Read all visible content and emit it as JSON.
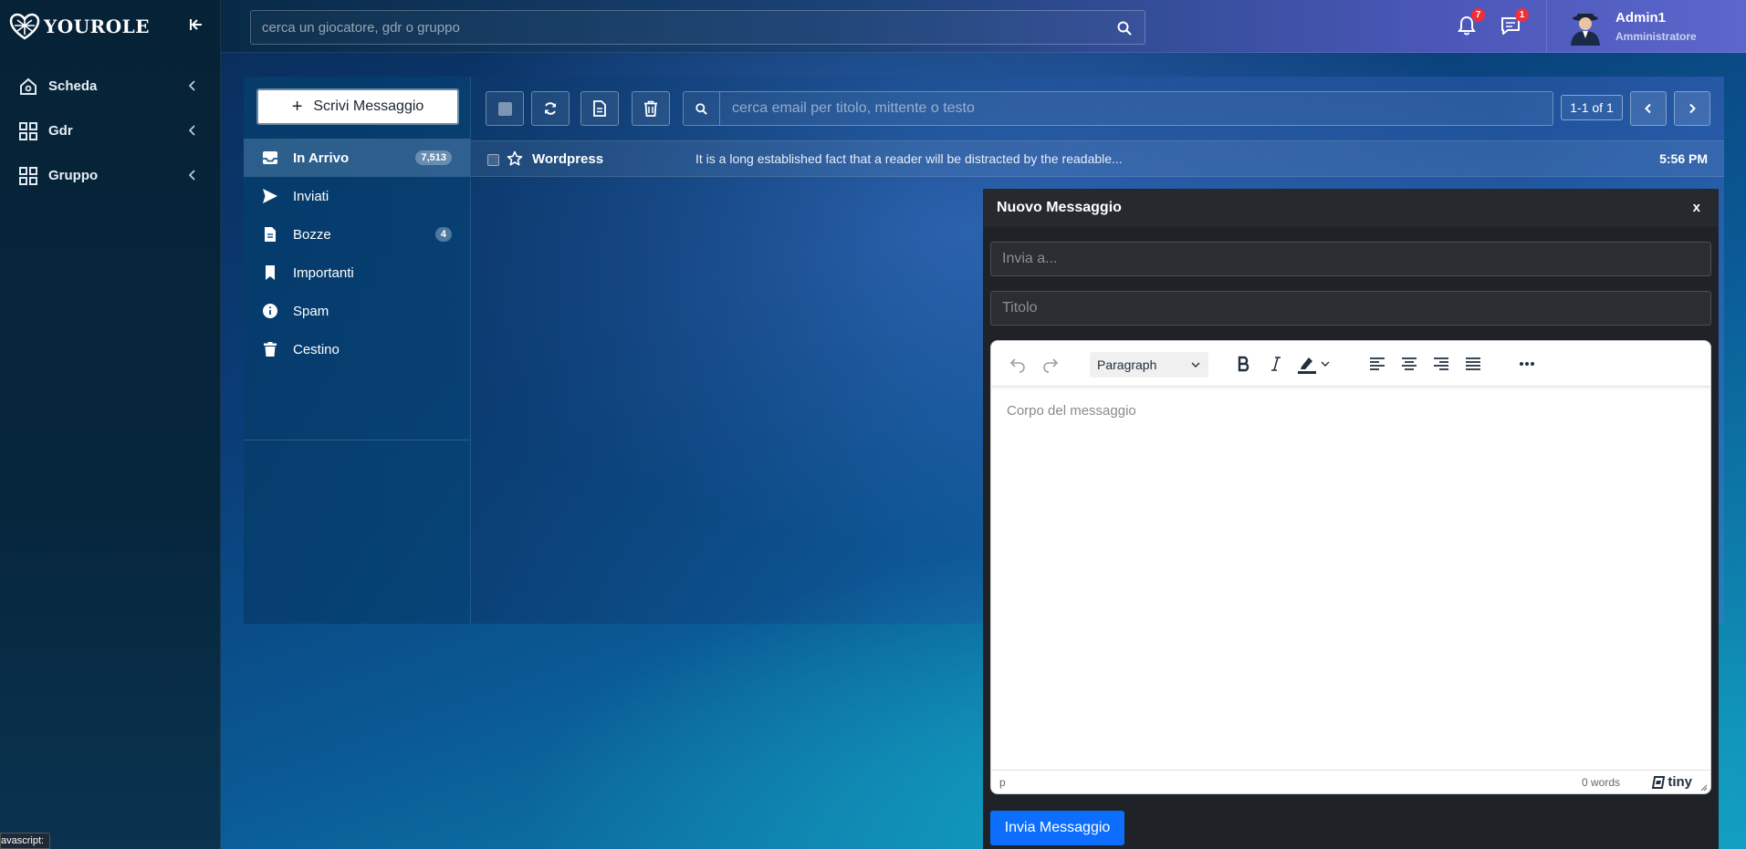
{
  "app": {
    "logo_text": "YOUROLE",
    "status_bar_text": "avascript:"
  },
  "sidebar": {
    "items": [
      {
        "label": "Scheda",
        "icon": "home-icon"
      },
      {
        "label": "Gdr",
        "icon": "grid-icon"
      },
      {
        "label": "Gruppo",
        "icon": "grid-icon"
      }
    ]
  },
  "topbar": {
    "search_placeholder": "cerca un giocatore, gdr o gruppo",
    "notifications_count": "7",
    "messages_count": "1",
    "user_name": "Admin1",
    "user_role": "Amministratore"
  },
  "mail": {
    "compose_label": "Scrivi Messaggio",
    "folders": [
      {
        "label": "In Arrivo",
        "count": "7,513",
        "icon": "inbox-icon",
        "active": true
      },
      {
        "label": "Inviati",
        "count": "",
        "icon": "send-icon",
        "active": false
      },
      {
        "label": "Bozze",
        "count": "4",
        "icon": "file-icon",
        "active": false
      },
      {
        "label": "Importanti",
        "count": "",
        "icon": "bookmark-icon",
        "active": false
      },
      {
        "label": "Spam",
        "count": "",
        "icon": "info-icon",
        "active": false
      },
      {
        "label": "Cestino",
        "count": "",
        "icon": "trash-icon",
        "active": false
      }
    ],
    "search_placeholder": "cerca email per titolo, mittente o testo",
    "pager_text": "1-1 of 1",
    "messages": [
      {
        "sender": "Wordpress",
        "subject": "It is a long established fact that a reader will be distracted by the readable...",
        "time": "5:56 PM"
      }
    ]
  },
  "compose": {
    "title": "Nuovo Messaggio",
    "close_label": "x",
    "to_placeholder": "Invia a...",
    "title_placeholder": "Titolo",
    "format_select": "Paragraph",
    "body_placeholder": "Corpo del messaggio",
    "status_path": "p",
    "word_count": "0 words",
    "brand": "tiny",
    "send_label": "Invia Messaggio"
  },
  "colors": {
    "accent_blue": "#0d6efd",
    "badge_red": "#ef2f3a"
  }
}
